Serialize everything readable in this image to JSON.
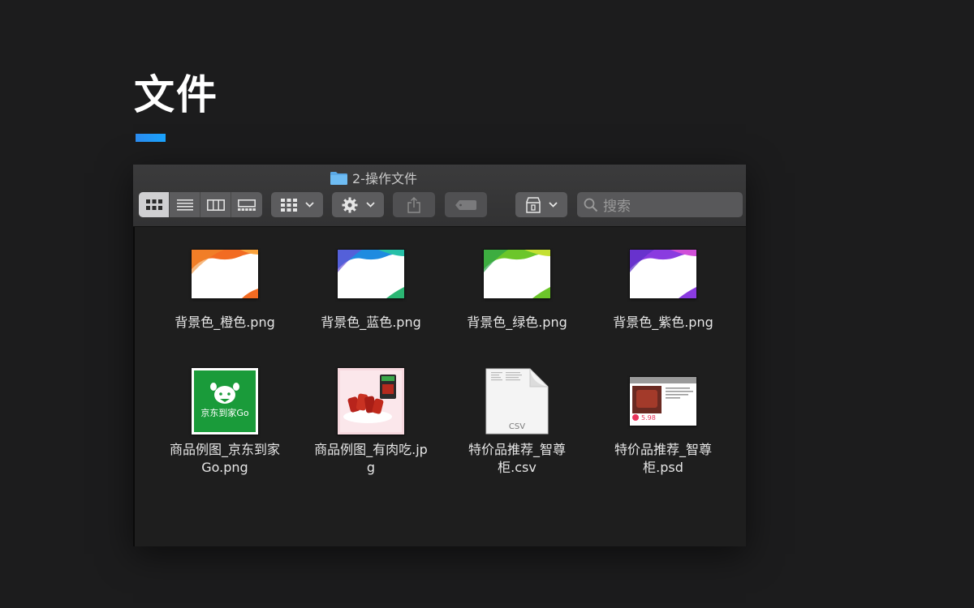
{
  "page": {
    "title": "文件"
  },
  "window": {
    "title": "2-操作文件",
    "folder_icon": "folder-icon",
    "accent": "#2c8cf0"
  },
  "toolbar": {
    "view_modes": [
      "icon-view",
      "list-view",
      "column-view",
      "gallery-view"
    ],
    "active_view": "icon-view",
    "group_icon": "group-grid-icon",
    "action_icon": "gear-icon",
    "share_icon": "share-icon",
    "tag_icon": "tag-icon",
    "storage_icon": "storage-icon",
    "search_placeholder": "搜索"
  },
  "files": [
    {
      "name": "背景色_橙色.png",
      "type": "bg-orange",
      "color": "#f26b22"
    },
    {
      "name": "背景色_蓝色.png",
      "type": "bg-blue",
      "color": "#1f8be0"
    },
    {
      "name": "背景色_绿色.png",
      "type": "bg-green",
      "color": "#6cc62a"
    },
    {
      "name": "背景色_紫色.png",
      "type": "bg-purple",
      "color": "#8a3be0"
    },
    {
      "name": "商品例图_京东到家Go.png",
      "type": "jd-go",
      "color": "#1a9b3a",
      "logo_text": "京东到家Go"
    },
    {
      "name": "商品例图_有肉吃.jpg",
      "type": "meat"
    },
    {
      "name": "特价品推荐_智尊柜.csv",
      "type": "csv",
      "badge": "CSV"
    },
    {
      "name": "特价品推荐_智尊柜.psd",
      "type": "psd",
      "price": "5.98"
    }
  ]
}
